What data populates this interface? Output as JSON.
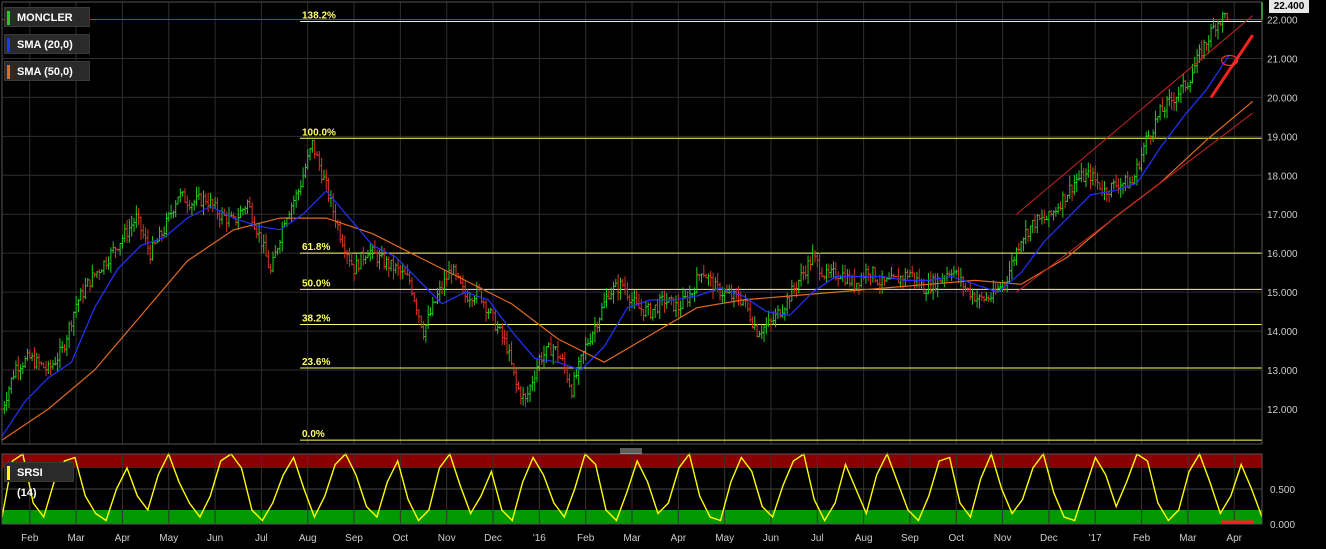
{
  "instrument": "MONCLER",
  "legend": {
    "main": "MONCLER",
    "sma20": "SMA (20,0)",
    "sma50": "SMA (50,0)",
    "srsi": "SRSI (14)"
  },
  "last_price_label": "22.400",
  "colors": {
    "background": "#000000",
    "up_bar": "#22cc22",
    "down_bar": "#dd3322",
    "sma20": "#2233ff",
    "sma50": "#e06a20",
    "fib": "#ffff66",
    "channel": "#cc2222",
    "grid": "#2e2e2e",
    "srsi_line": "#ffff00",
    "overbought_band": "#8a0000",
    "oversold_band": "#009900"
  },
  "chart_data": [
    {
      "type": "line",
      "title": "MONCLER",
      "y_ticks": [
        "12.000",
        "13.000",
        "14.000",
        "15.000",
        "16.000",
        "17.000",
        "18.000",
        "19.000",
        "20.000",
        "21.000",
        "22.000"
      ],
      "ylim": [
        11.1,
        22.45
      ],
      "x_ticks": [
        "Feb",
        "Mar",
        "Apr",
        "May",
        "Jun",
        "Jul",
        "Aug",
        "Sep",
        "Oct",
        "Nov",
        "Dec",
        "'16",
        "Feb",
        "Mar",
        "Apr",
        "May",
        "Jun",
        "Jul",
        "Aug",
        "Sep",
        "Oct",
        "Nov",
        "Dec",
        "'17",
        "Feb",
        "Mar",
        "Apr"
      ],
      "x_range_months": [
        0,
        27.2
      ],
      "grid": true,
      "fibonacci": {
        "levels": [
          {
            "label": "138.2%",
            "value": 21.95
          },
          {
            "label": "100.0%",
            "value": 18.95
          },
          {
            "label": "61.8%",
            "value": 16.0
          },
          {
            "label": "50.0%",
            "value": 15.07
          },
          {
            "label": "38.2%",
            "value": 14.17
          },
          {
            "label": "23.6%",
            "value": 13.05
          },
          {
            "label": "0.0%",
            "value": 11.2
          }
        ]
      },
      "price_path": [
        [
          0,
          12.0
        ],
        [
          0.3,
          13.1
        ],
        [
          0.6,
          13.3
        ],
        [
          1.0,
          13.0
        ],
        [
          1.3,
          13.5
        ],
        [
          1.6,
          14.7
        ],
        [
          1.9,
          15.3
        ],
        [
          2.3,
          15.9
        ],
        [
          2.6,
          16.4
        ],
        [
          2.9,
          16.9
        ],
        [
          3.2,
          16.0
        ],
        [
          3.5,
          16.6
        ],
        [
          3.8,
          17.5
        ],
        [
          4.1,
          17.3
        ],
        [
          4.4,
          17.4
        ],
        [
          4.7,
          17.0
        ],
        [
          5.0,
          16.8
        ],
        [
          5.3,
          17.3
        ],
        [
          5.6,
          16.3
        ],
        [
          5.8,
          15.5
        ],
        [
          6.1,
          16.9
        ],
        [
          6.4,
          17.6
        ],
        [
          6.7,
          18.8
        ],
        [
          7.0,
          17.7
        ],
        [
          7.3,
          16.5
        ],
        [
          7.6,
          15.6
        ],
        [
          7.9,
          16.1
        ],
        [
          8.2,
          15.8
        ],
        [
          8.5,
          15.6
        ],
        [
          8.8,
          15.3
        ],
        [
          9.1,
          14.0
        ],
        [
          9.4,
          14.9
        ],
        [
          9.7,
          15.6
        ],
        [
          10.0,
          14.9
        ],
        [
          10.3,
          15.0
        ],
        [
          10.6,
          14.3
        ],
        [
          10.9,
          13.6
        ],
        [
          11.1,
          12.6
        ],
        [
          11.3,
          12.2
        ],
        [
          11.6,
          13.3
        ],
        [
          11.9,
          13.6
        ],
        [
          12.1,
          13.2
        ],
        [
          12.3,
          12.5
        ],
        [
          12.6,
          13.6
        ],
        [
          12.9,
          14.4
        ],
        [
          13.1,
          15.0
        ],
        [
          13.4,
          15.2
        ],
        [
          13.7,
          14.6
        ],
        [
          14.0,
          14.5
        ],
        [
          14.3,
          14.8
        ],
        [
          14.6,
          14.6
        ],
        [
          14.9,
          15.0
        ],
        [
          15.1,
          15.6
        ],
        [
          15.4,
          15.1
        ],
        [
          15.7,
          14.9
        ],
        [
          16.0,
          14.8
        ],
        [
          16.3,
          14.0
        ],
        [
          16.6,
          14.2
        ],
        [
          16.9,
          14.7
        ],
        [
          17.2,
          15.3
        ],
        [
          17.5,
          15.9
        ],
        [
          17.8,
          15.4
        ],
        [
          18.1,
          15.5
        ],
        [
          18.4,
          15.2
        ],
        [
          18.7,
          15.6
        ],
        [
          19.0,
          15.2
        ],
        [
          19.3,
          15.3
        ],
        [
          19.6,
          15.5
        ],
        [
          19.9,
          15.1
        ],
        [
          20.2,
          15.3
        ],
        [
          20.5,
          15.6
        ],
        [
          20.8,
          15.1
        ],
        [
          21.1,
          14.8
        ],
        [
          21.4,
          14.9
        ],
        [
          21.7,
          15.4
        ],
        [
          22.0,
          16.4
        ],
        [
          22.3,
          16.8
        ],
        [
          22.6,
          16.9
        ],
        [
          22.9,
          17.4
        ],
        [
          23.2,
          17.9
        ],
        [
          23.5,
          18.0
        ],
        [
          23.8,
          17.6
        ],
        [
          24.1,
          17.8
        ],
        [
          24.4,
          17.8
        ],
        [
          24.7,
          18.9
        ],
        [
          25.0,
          19.6
        ],
        [
          25.3,
          20.0
        ],
        [
          25.6,
          20.4
        ],
        [
          25.9,
          21.2
        ],
        [
          26.2,
          21.9
        ],
        [
          26.5,
          22.2
        ]
      ],
      "sma20_path": [
        [
          0,
          11.3
        ],
        [
          0.5,
          12.2
        ],
        [
          1.0,
          12.8
        ],
        [
          1.5,
          13.2
        ],
        [
          2.0,
          14.6
        ],
        [
          2.5,
          15.6
        ],
        [
          3.0,
          16.2
        ],
        [
          3.5,
          16.4
        ],
        [
          4.0,
          16.9
        ],
        [
          4.5,
          17.2
        ],
        [
          5.0,
          16.9
        ],
        [
          5.5,
          16.7
        ],
        [
          6.0,
          16.6
        ],
        [
          6.5,
          17.0
        ],
        [
          7.0,
          17.6
        ],
        [
          7.5,
          16.9
        ],
        [
          8.0,
          16.2
        ],
        [
          8.5,
          15.9
        ],
        [
          9.0,
          15.3
        ],
        [
          9.5,
          14.7
        ],
        [
          10.0,
          15.0
        ],
        [
          10.5,
          14.8
        ],
        [
          11.0,
          14.0
        ],
        [
          11.5,
          13.3
        ],
        [
          12.0,
          13.2
        ],
        [
          12.5,
          13.0
        ],
        [
          13.0,
          13.6
        ],
        [
          13.5,
          14.6
        ],
        [
          14.0,
          14.8
        ],
        [
          14.5,
          14.8
        ],
        [
          15.0,
          14.9
        ],
        [
          15.5,
          15.1
        ],
        [
          16.0,
          14.9
        ],
        [
          16.5,
          14.5
        ],
        [
          17.0,
          14.4
        ],
        [
          17.5,
          15.0
        ],
        [
          18.0,
          15.4
        ],
        [
          18.5,
          15.4
        ],
        [
          19.0,
          15.4
        ],
        [
          19.5,
          15.3
        ],
        [
          20.0,
          15.3
        ],
        [
          20.5,
          15.4
        ],
        [
          21.0,
          15.2
        ],
        [
          21.5,
          15.0
        ],
        [
          22.0,
          15.5
        ],
        [
          22.5,
          16.3
        ],
        [
          23.0,
          16.9
        ],
        [
          23.5,
          17.5
        ],
        [
          24.0,
          17.6
        ],
        [
          24.5,
          17.8
        ],
        [
          25.0,
          18.7
        ],
        [
          25.5,
          19.5
        ],
        [
          26.0,
          20.2
        ],
        [
          26.5,
          21.1
        ]
      ],
      "sma50_path": [
        [
          0,
          11.2
        ],
        [
          1.0,
          12.0
        ],
        [
          2.0,
          13.0
        ],
        [
          3.0,
          14.4
        ],
        [
          4.0,
          15.8
        ],
        [
          5.0,
          16.6
        ],
        [
          6.0,
          16.9
        ],
        [
          7.0,
          16.9
        ],
        [
          8.0,
          16.5
        ],
        [
          9.0,
          15.9
        ],
        [
          10.0,
          15.3
        ],
        [
          11.0,
          14.7
        ],
        [
          12.0,
          13.8
        ],
        [
          13.0,
          13.2
        ],
        [
          14.0,
          13.9
        ],
        [
          15.0,
          14.6
        ],
        [
          16.0,
          14.8
        ],
        [
          17.0,
          14.9
        ],
        [
          18.0,
          15.0
        ],
        [
          19.0,
          15.1
        ],
        [
          20.0,
          15.2
        ],
        [
          21.0,
          15.3
        ],
        [
          22.0,
          15.2
        ],
        [
          23.0,
          15.9
        ],
        [
          24.0,
          16.9
        ],
        [
          25.0,
          17.8
        ],
        [
          26.0,
          18.9
        ],
        [
          27.0,
          19.9
        ]
      ],
      "channel": {
        "upper": [
          [
            21.9,
            17.0
          ],
          [
            27.0,
            22.1
          ]
        ],
        "lower": [
          [
            21.9,
            15.0
          ],
          [
            27.0,
            19.6
          ]
        ]
      }
    },
    {
      "type": "line",
      "title": "SRSI (14)",
      "y_ticks": [
        "0.000",
        "0.500"
      ],
      "ylim": [
        0,
        1
      ],
      "overbought": 0.8,
      "oversold": 0.2,
      "series_values": [
        0.1,
        0.9,
        1.0,
        0.3,
        0.1,
        0.6,
        0.9,
        0.95,
        0.4,
        0.15,
        0.05,
        0.5,
        0.8,
        0.4,
        0.2,
        0.7,
        1.0,
        0.6,
        0.3,
        0.1,
        0.4,
        0.9,
        1.0,
        0.8,
        0.2,
        0.05,
        0.3,
        0.7,
        0.95,
        0.5,
        0.1,
        0.4,
        0.85,
        1.0,
        0.7,
        0.25,
        0.1,
        0.6,
        0.9,
        0.35,
        0.05,
        0.2,
        0.8,
        1.0,
        0.55,
        0.15,
        0.4,
        0.75,
        0.2,
        0.05,
        0.6,
        0.95,
        0.7,
        0.3,
        0.1,
        0.5,
        1.0,
        0.85,
        0.2,
        0.05,
        0.45,
        0.9,
        0.6,
        0.15,
        0.3,
        0.8,
        1.0,
        0.4,
        0.1,
        0.05,
        0.6,
        0.95,
        0.75,
        0.25,
        0.1,
        0.55,
        0.9,
        1.0,
        0.35,
        0.05,
        0.3,
        0.85,
        0.5,
        0.15,
        0.7,
        1.0,
        0.6,
        0.2,
        0.05,
        0.4,
        0.9,
        0.95,
        0.3,
        0.1,
        0.65,
        1.0,
        0.5,
        0.15,
        0.35,
        0.8,
        1.0,
        0.45,
        0.1,
        0.05,
        0.5,
        0.95,
        0.7,
        0.25,
        0.6,
        1.0,
        0.9,
        0.3,
        0.05,
        0.2,
        0.75,
        1.0,
        0.6,
        0.15,
        0.4,
        0.85,
        0.5,
        0.1
      ]
    }
  ]
}
